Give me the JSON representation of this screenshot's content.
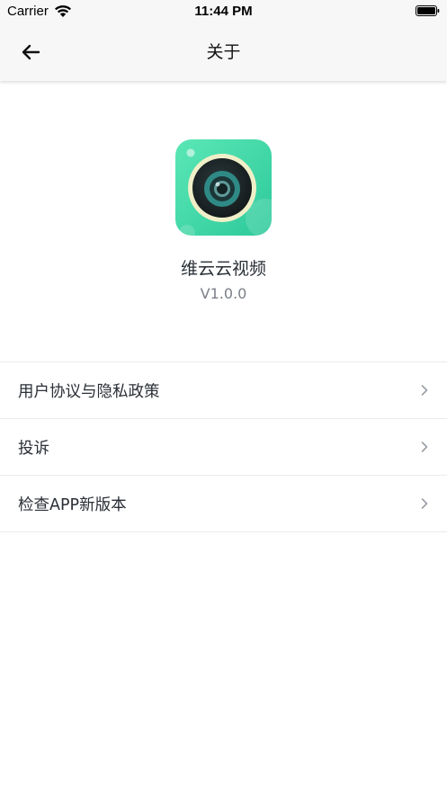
{
  "status_bar": {
    "carrier": "Carrier",
    "time": "11:44 PM"
  },
  "nav": {
    "title": "关于",
    "back_icon": "arrow-left-icon"
  },
  "app": {
    "icon": "camera-lens-app-icon",
    "name": "维云云视频",
    "version": "V1.0.0"
  },
  "menu": {
    "items": [
      {
        "label": "用户协议与隐私政策",
        "icon": "chevron-right-icon"
      },
      {
        "label": "投诉",
        "icon": "chevron-right-icon"
      },
      {
        "label": "检查APP新版本",
        "icon": "chevron-right-icon"
      }
    ]
  },
  "colors": {
    "app_icon_gradient_start": "#5be7b6",
    "app_icon_gradient_end": "#2dc99a",
    "text_primary": "#2a2f36",
    "text_secondary": "#7a7f87",
    "divider": "#ebebeb",
    "chevron": "#9aa0a6"
  }
}
